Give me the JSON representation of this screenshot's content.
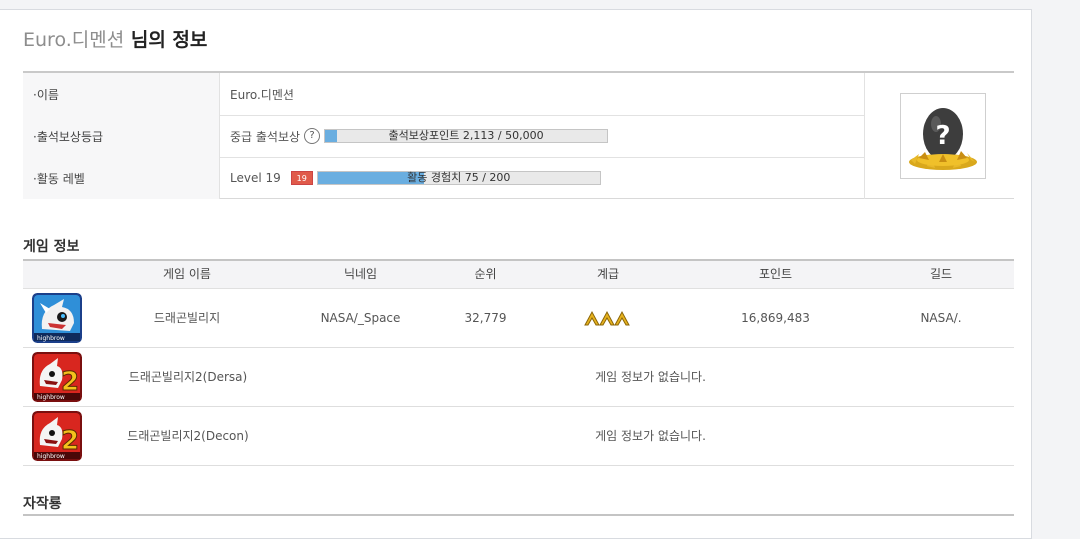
{
  "header": {
    "nickname": "Euro.디멘션",
    "title_suffix": " 님의 정보"
  },
  "profile": {
    "name_label": "·이름",
    "name_value": "Euro.디멘션",
    "attendance_label": "·출석보상등급",
    "attendance_grade": "중급 출석보상",
    "attendance_help": "?",
    "attendance_bar_text": "출석보상포인트 2,113 / 50,000",
    "attendance_progress": 0.04226,
    "activity_label": "·활동 레벨",
    "activity_level": "Level 19",
    "activity_badge": "19",
    "activity_bar_text": "활동 경험치 75 / 200",
    "activity_progress": 0.375,
    "avatar_icon": "question-mark-egg-icon"
  },
  "games_section_title": "게임 정보",
  "games_table": {
    "headers": [
      "게임 이름",
      "닉네임",
      "순위",
      "계급",
      "포인트",
      "길드"
    ],
    "rows": [
      {
        "name": "드래곤빌리지",
        "nickname": "NASA/_Space",
        "rank": "32,779",
        "grade_icon": "triple-gold-chevron-icon",
        "points": "16,869,483",
        "guild": "NASA/.",
        "icon": "dragon-village-icon"
      },
      {
        "name": "드래곤빌리지2(Dersa)",
        "empty_message": "게임 정보가 없습니다.",
        "icon": "dragon-village-2-icon"
      },
      {
        "name": "드래곤빌리지2(Decon)",
        "empty_message": "게임 정보가 없습니다.",
        "icon": "dragon-village-2-icon"
      }
    ]
  },
  "creations_section_title": "자작룡",
  "colors": {
    "progress_fill": "#6aaee0",
    "badge": "#e05a4a",
    "nickname": "#8d8d8d"
  }
}
